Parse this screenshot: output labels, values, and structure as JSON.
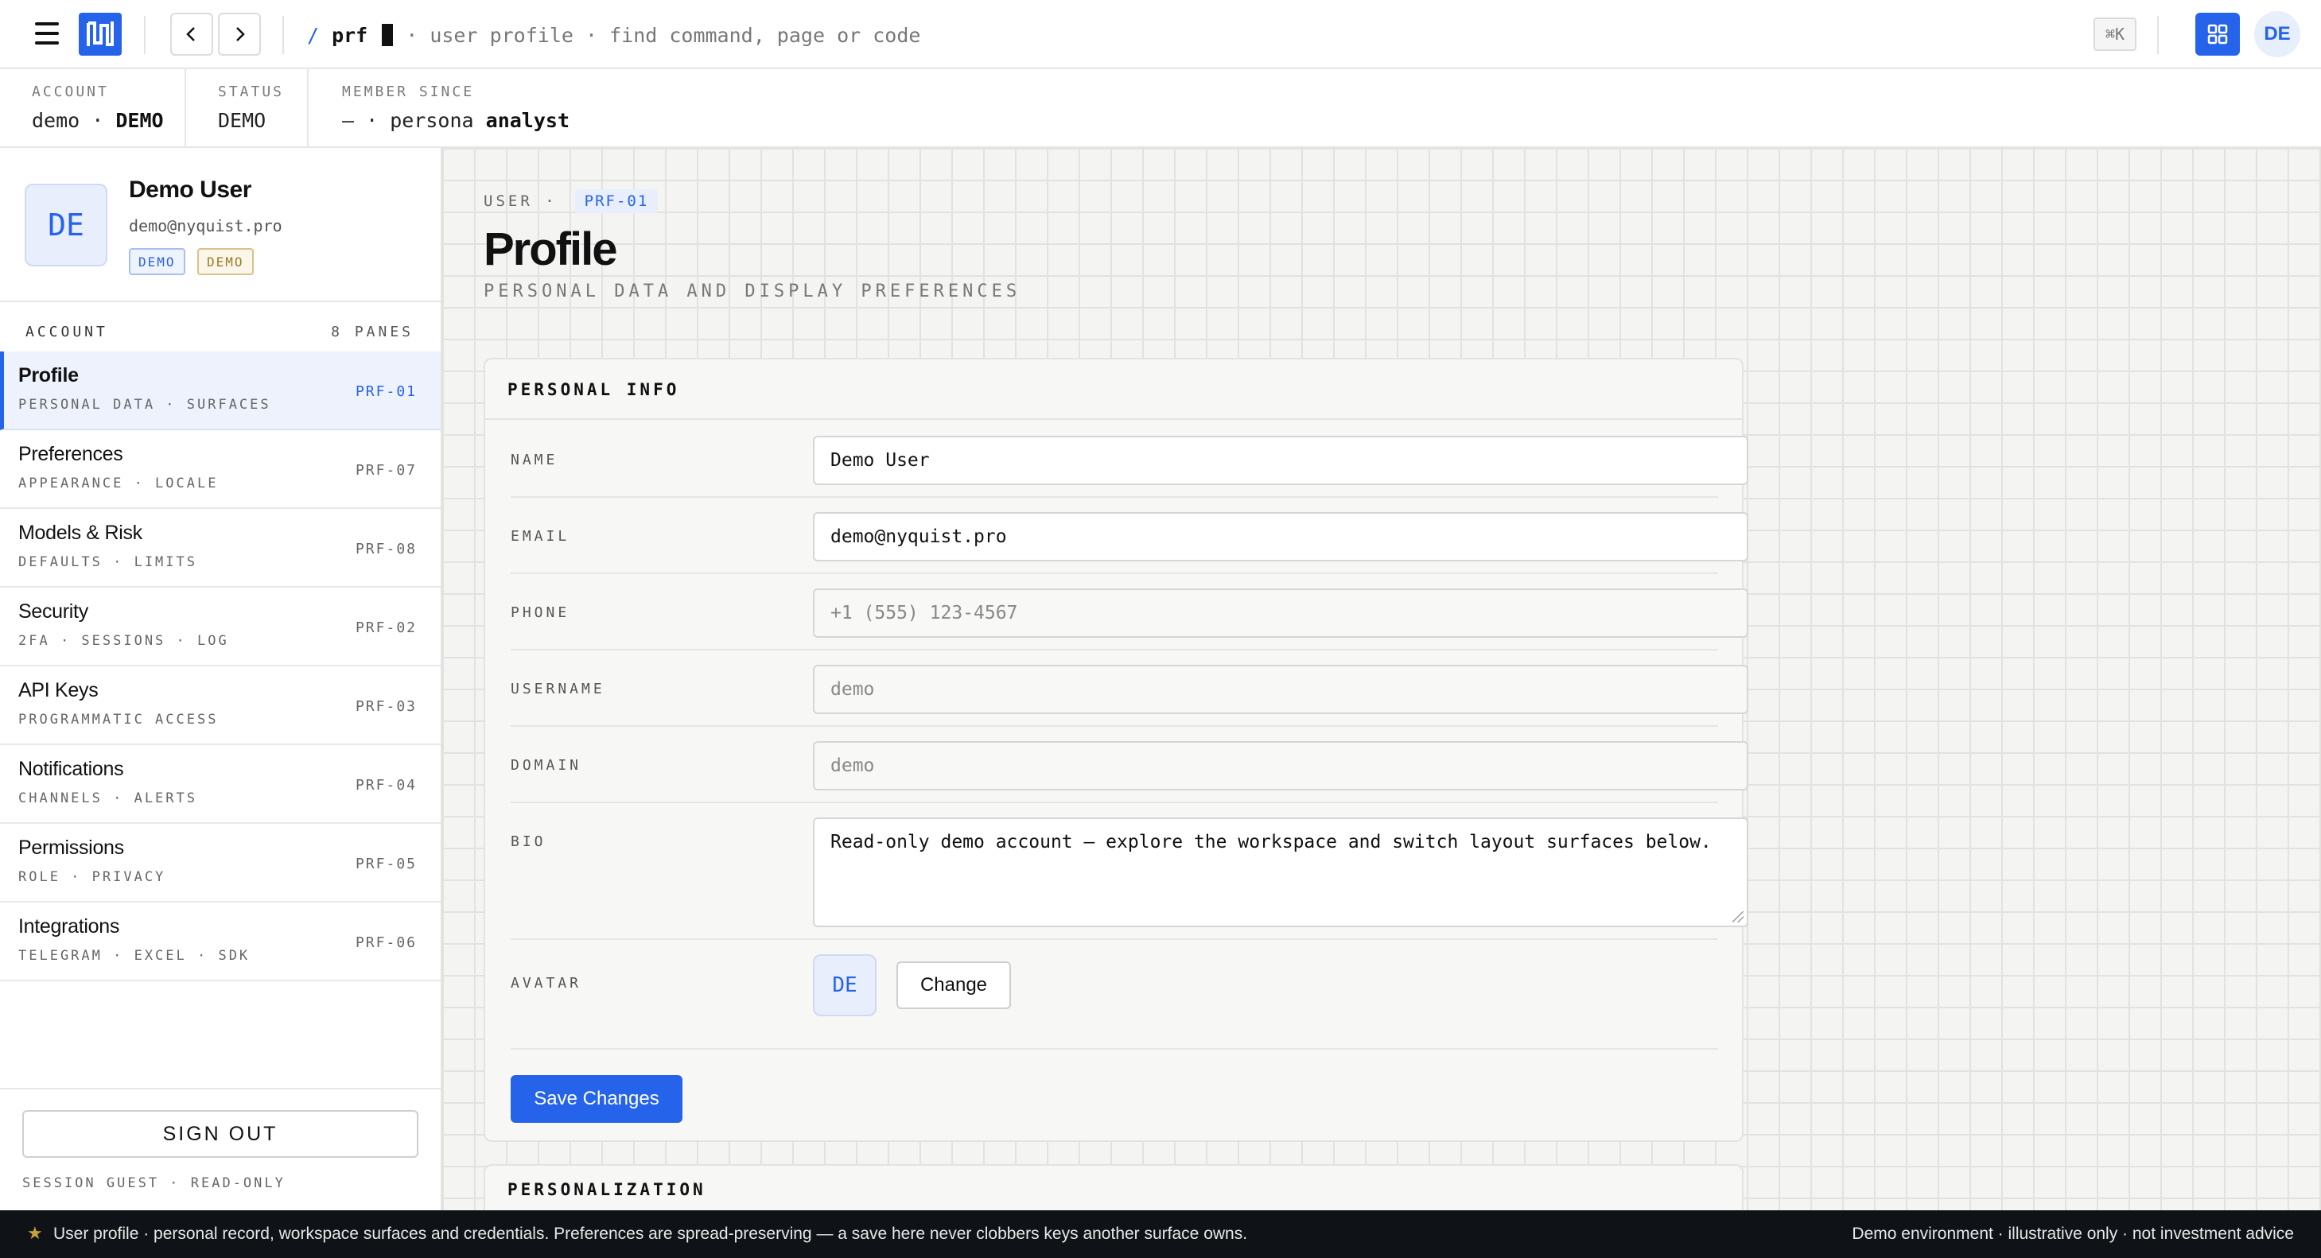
{
  "topbar": {
    "cmd_slash": "/",
    "cmd_prefix": "prf",
    "cmd_hint": "· user profile · find command, page or code",
    "shortcut": "⌘K",
    "avatar_initials": "DE",
    "accent": "#2563eb"
  },
  "info": {
    "account_label": "ACCOUNT",
    "account_value_a": "demo ·",
    "account_value_b": "DEMO",
    "status_label": "STATUS",
    "status_value": "DEMO",
    "member_label": "MEMBER SINCE",
    "member_value_a": "— · persona",
    "member_value_b": "analyst"
  },
  "sidebar": {
    "avatar_initials": "DE",
    "user_name": "Demo User",
    "user_email": "demo@nyquist.pro",
    "badge_a": "DEMO",
    "badge_b": "DEMO",
    "section_title": "ACCOUNT",
    "section_count": "8 PANES",
    "items": [
      {
        "title": "Profile",
        "sub": "PERSONAL DATA · SURFACES",
        "code": "PRF-01"
      },
      {
        "title": "Preferences",
        "sub": "APPEARANCE · LOCALE",
        "code": "PRF-07"
      },
      {
        "title": "Models & Risk",
        "sub": "DEFAULTS · LIMITS",
        "code": "PRF-08"
      },
      {
        "title": "Security",
        "sub": "2FA · SESSIONS · LOG",
        "code": "PRF-02"
      },
      {
        "title": "API Keys",
        "sub": "PROGRAMMATIC ACCESS",
        "code": "PRF-03"
      },
      {
        "title": "Notifications",
        "sub": "CHANNELS · ALERTS",
        "code": "PRF-04"
      },
      {
        "title": "Permissions",
        "sub": "ROLE · PRIVACY",
        "code": "PRF-05"
      },
      {
        "title": "Integrations",
        "sub": "TELEGRAM · EXCEL · SDK",
        "code": "PRF-06"
      }
    ],
    "sign_out": "SIGN OUT",
    "session_text": "SESSION GUEST · READ-ONLY"
  },
  "main": {
    "crumb_label": "USER ·",
    "crumb_code": "PRF-01",
    "title": "Profile",
    "subtitle": "PERSONAL DATA AND DISPLAY PREFERENCES",
    "card_title": "PERSONAL INFO",
    "fields": {
      "name_label": "NAME",
      "name_value": "Demo User",
      "email_label": "EMAIL",
      "email_value": "demo@nyquist.pro",
      "phone_label": "PHONE",
      "phone_placeholder": "+1 (555) 123-4567",
      "username_label": "USERNAME",
      "username_placeholder": "demo",
      "domain_label": "DOMAIN",
      "domain_placeholder": "demo",
      "bio_label": "BIO",
      "bio_value": "Read-only demo account — explore the workspace and switch layout surfaces below.",
      "avatar_label": "AVATAR",
      "avatar_initials": "DE",
      "change_label": "Change"
    },
    "save_label": "Save Changes",
    "card2_title": "PERSONALIZATION"
  },
  "footer": {
    "star": "★",
    "left_text": "User profile · personal record, workspace surfaces and credentials. Preferences are spread-preserving — a save here never clobbers keys another surface owns.",
    "right_text": "Demo environment · illustrative only · not investment advice"
  }
}
